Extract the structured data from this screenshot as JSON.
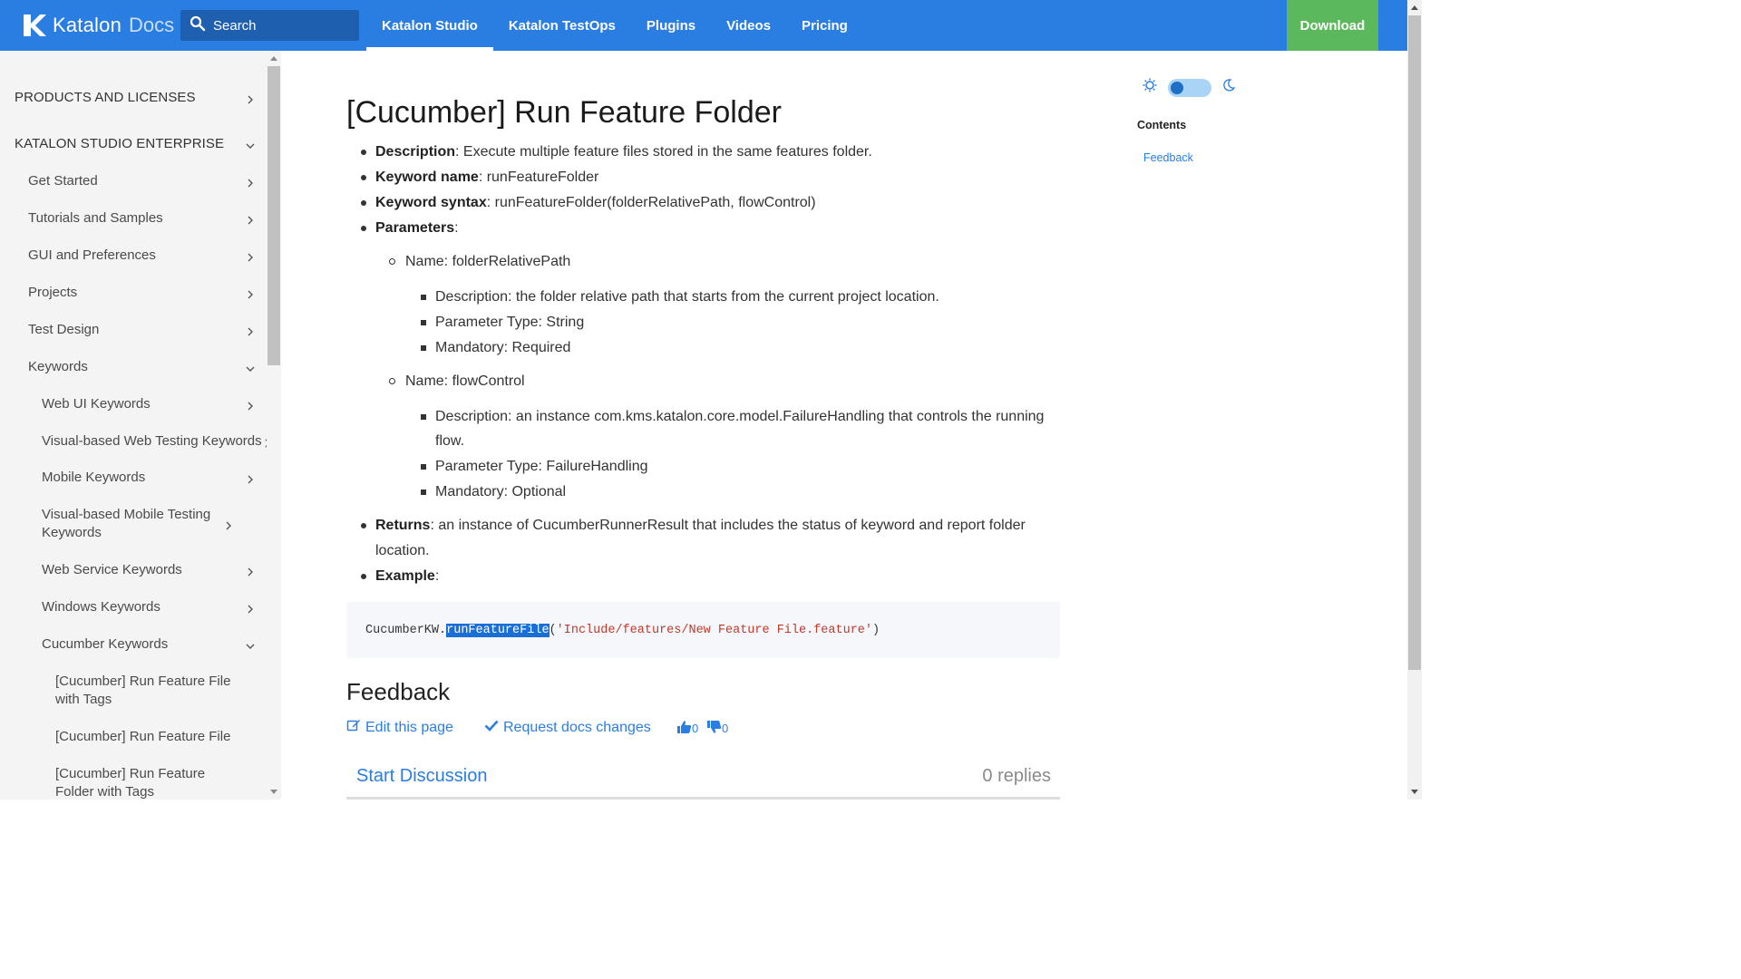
{
  "header": {
    "logo_text": "Katalon",
    "logo_docs": "Docs",
    "search_placeholder": "Search",
    "nav": [
      "Katalon Studio",
      "Katalon TestOps",
      "Plugins",
      "Videos",
      "Pricing"
    ],
    "active_nav": "Katalon Studio",
    "download_label": "Download",
    "brand_color": "#2a7de1",
    "download_color": "#5cb85c"
  },
  "sidebar": {
    "items": [
      {
        "label": "PRODUCTS AND LICENSES",
        "chevron": "chevron-right"
      },
      {
        "label": "KATALON STUDIO ENTERPRISE",
        "chevron": "chevron-down"
      },
      {
        "label": "Get Started",
        "chevron": "chevron-right"
      },
      {
        "label": "Tutorials and Samples",
        "chevron": "chevron-right"
      },
      {
        "label": "GUI and Preferences",
        "chevron": "chevron-right"
      },
      {
        "label": "Projects",
        "chevron": "chevron-right"
      },
      {
        "label": "Test Design",
        "chevron": "chevron-right"
      },
      {
        "label": "Keywords",
        "chevron": "chevron-down"
      },
      {
        "label": "Web UI Keywords",
        "chevron": "chevron-right"
      },
      {
        "label": "Visual-based Web Testing Keywords",
        "chevron": "chevron-right"
      },
      {
        "label": "Mobile Keywords",
        "chevron": "chevron-right"
      },
      {
        "label": "Visual-based Mobile Testing Keywords",
        "chevron": "chevron-right"
      },
      {
        "label": "Web Service Keywords",
        "chevron": "chevron-right"
      },
      {
        "label": "Windows Keywords",
        "chevron": "chevron-right"
      },
      {
        "label": "Cucumber Keywords",
        "chevron": "chevron-down"
      },
      {
        "label": "[Cucumber] Run Feature File with Tags",
        "chevron": ""
      },
      {
        "label": "[Cucumber] Run Feature File",
        "chevron": ""
      },
      {
        "label": "[Cucumber] Run Feature Folder with Tags",
        "chevron": ""
      }
    ]
  },
  "article": {
    "title": "[Cucumber] Run Feature Folder",
    "description_label": "Description",
    "description": ": Execute multiple feature files stored in the same features folder.",
    "keyword_name_label": "Keyword name",
    "keyword_name": ": runFeatureFolder",
    "keyword_syntax_label": "Keyword syntax",
    "keyword_syntax": ": runFeatureFolder(folderRelativePath, flowControl)",
    "parameters_label": "Parameters",
    "parameters_suffix": ":",
    "params": [
      {
        "name": "Name: folderRelativePath",
        "details": [
          "Description: the folder relative path that starts from the current project location.",
          "Parameter Type: String",
          "Mandatory: Required"
        ]
      },
      {
        "name": "Name: flowControl",
        "details": [
          "Description: an instance com.kms.katalon.core.model.FailureHandling that controls the running",
          "flow.",
          "Parameter Type: FailureHandling",
          "Mandatory: Optional"
        ]
      }
    ],
    "returns_label": "Returns",
    "returns_line1": ": an instance of CucumberRunnerResult that includes the status of keyword and report folder",
    "returns_line2": "location.",
    "example_label": "Example",
    "example_suffix": ":",
    "code": {
      "prefix": "CucumberKW.",
      "selected": "runFeatureFile",
      "open": "(",
      "string": "'Include/features/New Feature File.feature'",
      "close": ")"
    }
  },
  "feedback": {
    "heading": "Feedback",
    "edit_label": "Edit this page",
    "request_label": "Request docs changes",
    "upvotes": "0",
    "downvotes": "0",
    "start_discussion": "Start Discussion",
    "replies": "0 replies"
  },
  "right_panel": {
    "contents_label": "Contents",
    "toc": [
      "Feedback"
    ],
    "theme_mode": "light"
  }
}
